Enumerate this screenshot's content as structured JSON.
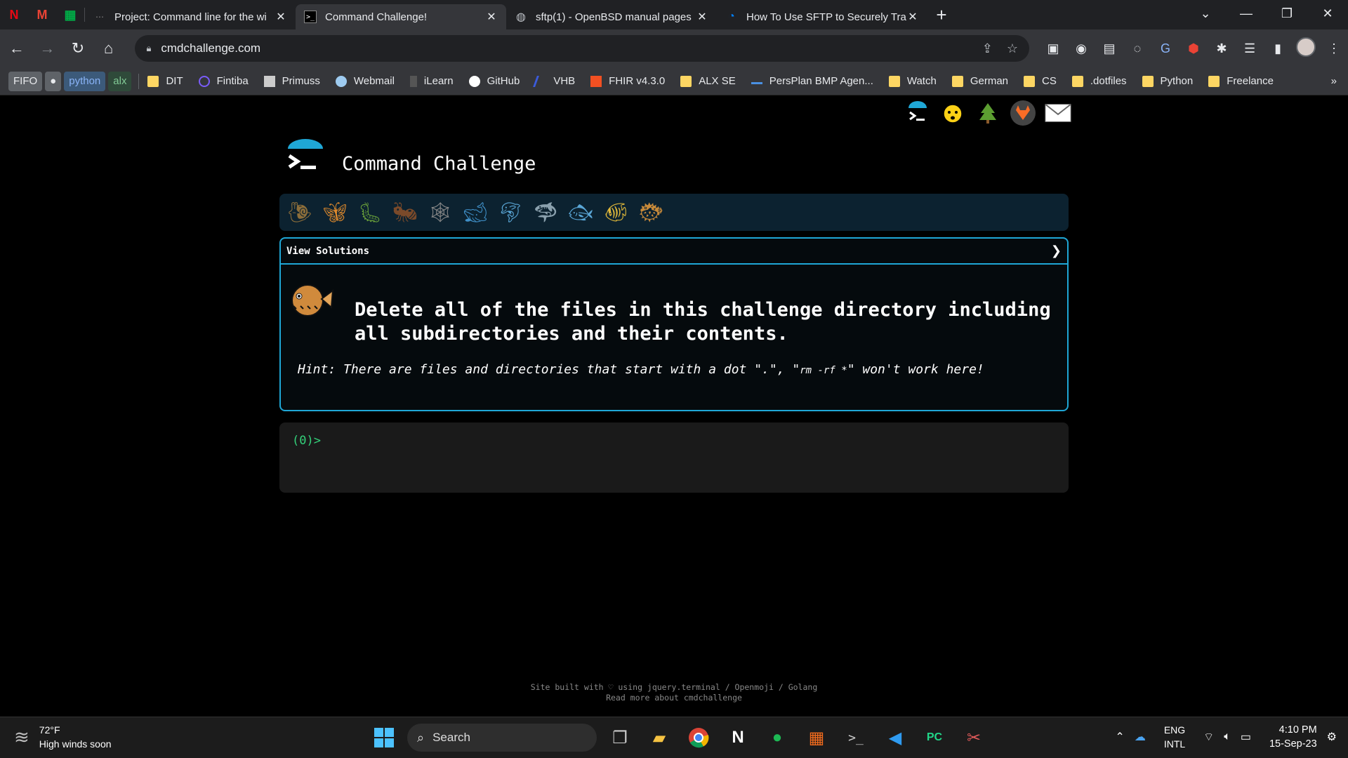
{
  "browser": {
    "pinned_tabs": [
      {
        "icon": "netflix-icon",
        "glyph": "N",
        "color": "#e50914"
      },
      {
        "icon": "gmail-icon",
        "glyph": "M",
        "color": "#ea4335"
      },
      {
        "icon": "google-meet-icon",
        "glyph": "▦",
        "color": "#00ac47"
      }
    ],
    "tabs": [
      {
        "title": "Project: Command line for the wi",
        "icon": "project-icon",
        "active": false
      },
      {
        "title": "Command Challenge!",
        "icon": "terminal-icon",
        "active": true
      },
      {
        "title": "sftp(1) - OpenBSD manual pages",
        "icon": "globe-icon",
        "active": false
      },
      {
        "title": "How To Use SFTP to Securely Tra",
        "icon": "digitalocean-icon",
        "active": false
      }
    ],
    "url": "cmdchallenge.com",
    "bookmark_chips": [
      {
        "label": "FIFO",
        "bg": "#5f6368",
        "fg": "#e8eaed"
      },
      {
        "label": "●",
        "bg": "#5f6368",
        "fg": "#e8eaed"
      },
      {
        "label": "python",
        "bg": "#3c5a7a",
        "fg": "#8ab4f8"
      },
      {
        "label": "alx",
        "bg": "#2f4a3a",
        "fg": "#81c995"
      }
    ],
    "bookmarks": [
      {
        "label": "DIT",
        "icon": "folder-icon"
      },
      {
        "label": "Fintiba",
        "icon": "fintiba-icon"
      },
      {
        "label": "Primuss",
        "icon": "primuss-icon"
      },
      {
        "label": "Webmail",
        "icon": "webmail-icon"
      },
      {
        "label": "iLearn",
        "icon": "ilearn-icon"
      },
      {
        "label": "GitHub",
        "icon": "github-icon"
      },
      {
        "label": "VHB",
        "icon": "vhb-icon"
      },
      {
        "label": "FHIR v4.3.0",
        "icon": "fhir-icon"
      },
      {
        "label": "ALX SE",
        "icon": "folder-icon"
      },
      {
        "label": "PersPlan BMP Agen...",
        "icon": "persplan-icon"
      },
      {
        "label": "Watch",
        "icon": "folder-icon"
      },
      {
        "label": "German",
        "icon": "folder-icon"
      },
      {
        "label": "CS",
        "icon": "folder-icon"
      },
      {
        "label": ".dotfiles",
        "icon": "folder-icon"
      },
      {
        "label": "Python",
        "icon": "folder-icon"
      },
      {
        "label": "Freelance",
        "icon": "folder-icon"
      }
    ],
    "overflow": "»"
  },
  "page": {
    "title": "Command Challenge",
    "view_solutions": "View Solutions",
    "challenge_text": "Delete all of the files in this challenge directory including all subdirectories and their contents.",
    "hint_prefix": "Hint: There are files and directories that start with a dot \".\", \"",
    "hint_code": "rm -rf *",
    "hint_suffix": "\" won't work here!",
    "prompt": "(0)>",
    "footer_line1": "Site built with ♡ using jquery.terminal / Openmoji / Golang",
    "footer_line2": "Read more about cmdchallenge",
    "level_icons": [
      "snail-icon",
      "butterfly-icon",
      "caterpillar-icon",
      "ant-icon",
      "spider-web-icon",
      "whale-icon",
      "dolphin-icon",
      "shark-icon",
      "fish-icon",
      "tropical-fish-icon",
      "blowfish-icon"
    ],
    "top_icons": [
      "terminal-logo-icon",
      "hint-mind-blown-icon",
      "tree-icon",
      "gitlab-icon",
      "envelope-icon"
    ]
  },
  "taskbar": {
    "temperature": "72°F",
    "weather_text": "High winds soon",
    "search_label": "Search",
    "lang1": "ENG",
    "lang2": "INTL",
    "time": "4:10 PM",
    "date": "15-Sep-23"
  }
}
